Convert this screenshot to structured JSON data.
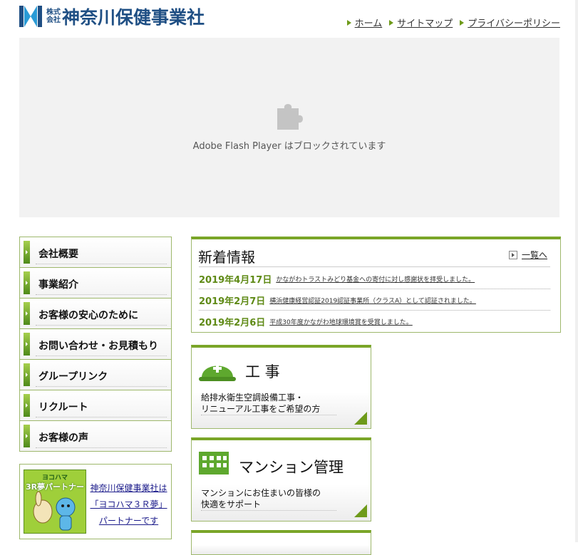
{
  "header": {
    "logo_small_line1": "株式",
    "logo_small_line2": "会社",
    "logo_name": "神奈川保健事業社",
    "links": [
      "ホーム",
      "サイトマップ",
      "プライバシーポリシー"
    ]
  },
  "flash": {
    "message": "Adobe Flash Player はブロックされています"
  },
  "nav": {
    "items": [
      "会社概要",
      "事業紹介",
      "お客様の安心のために",
      "お問い合わせ・お見積もり",
      "グループリンク",
      "リクルート",
      "お客様の声"
    ]
  },
  "banner": {
    "image_line1": "ヨコハマ",
    "image_line2": "3R夢パートナー",
    "text_line1": "神奈川保健事業社は",
    "text_line2": "「ヨコハマ３Ｒ夢」",
    "text_line3": "パートナーです"
  },
  "news": {
    "title": "新着情報",
    "more_label": "一覧へ",
    "items": [
      {
        "date": "2019年4月17日",
        "text": "かながわトラストみどり基金への寄付に対し感謝状を拝受しました。"
      },
      {
        "date": "2019年2月7日",
        "text": "横浜健康経営認証2019認証事業所（クラスA）として認証されました。"
      },
      {
        "date": "2019年2月6日",
        "text": "平成30年度かながわ地球環境賞を受賞しました。"
      }
    ]
  },
  "cards": [
    {
      "title": "工 事",
      "desc_line1": "給排水衛生空調設備工事・",
      "desc_line2": "リニューアル工事をご希望の方",
      "icon": "helmet-icon"
    },
    {
      "title": "マンション管理",
      "desc_line1": "マンションにお住まいの皆様の",
      "desc_line2": "快適をサポート",
      "icon": "building-icon"
    }
  ],
  "colors": {
    "brand_blue": "#1f4f84",
    "accent_green": "#6e9a1a",
    "date_green": "#5f8a16"
  }
}
